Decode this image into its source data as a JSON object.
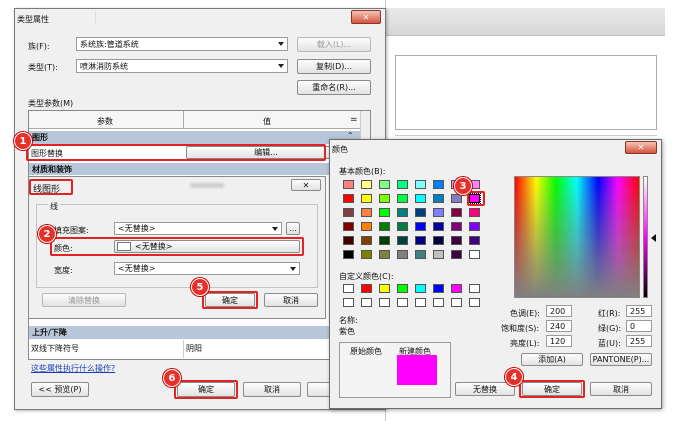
{
  "type_dialog": {
    "title": "类型属性",
    "family_label": "族(F):",
    "family_value": "系统族:管道系统",
    "type_label": "类型(T):",
    "type_value": "喷淋消防系统",
    "load_btn": "载入(L)...",
    "copy_btn": "复制(D)...",
    "rename_btn": "重命名(R)...",
    "params_label": "类型参数(M)",
    "col_param": "参数",
    "col_value": "值",
    "group_graphics": "图形",
    "row_override": "图形替换",
    "edit_btn": "编辑...",
    "group_material": "材质和装饰",
    "group_rise": "上升/下降",
    "row_double": "双线下降符号",
    "row_double_value": "阴阳",
    "help_link": "这些属性执行什么操作?",
    "preview_btn": "<< 预览(P)",
    "ok_btn": "确定",
    "cancel_btn": "取消"
  },
  "line_dialog": {
    "title": "线图形",
    "group": "线",
    "fill_label": "填充图案:",
    "fill_value": "<无替换>",
    "color_label": "颜色:",
    "color_value": "<无替换>",
    "width_label": "宽度:",
    "width_value": "<无替换>",
    "clear_btn": "清除替换",
    "ok_btn": "确定",
    "cancel_btn": "取消"
  },
  "color_dialog": {
    "title": "颜色",
    "basic_label": "基本颜色(B):",
    "custom_label": "自定义颜色(C):",
    "name_label": "名称:",
    "name_value": "紫色",
    "original_label": "原始颜色",
    "new_label": "新建颜色",
    "new_color": "#ff00ff",
    "hue_label": "色调(E):",
    "hue_value": "200",
    "sat_label": "饱和度(S):",
    "sat_value": "240",
    "lum_label": "亮度(L):",
    "lum_value": "120",
    "red_label": "红(R):",
    "red_value": "255",
    "green_label": "绿(G):",
    "green_value": "0",
    "blue_label": "蓝(U):",
    "blue_value": "255",
    "add_btn": "添加(A)",
    "pantone_btn": "PANTONE(P)...",
    "none_btn": "无替换",
    "ok_btn": "确定",
    "cancel_btn": "取消",
    "basic_colors": [
      [
        "#ff8080",
        "#ffff80",
        "#80ff80",
        "#00ff80",
        "#80ffff",
        "#0080ff",
        "#ff80c0",
        "#ff80ff"
      ],
      [
        "#ff0000",
        "#ffff00",
        "#80ff00",
        "#00ff40",
        "#00ffff",
        "#0080c0",
        "#8080c0",
        "#ff00ff"
      ],
      [
        "#804040",
        "#ff8040",
        "#00ff00",
        "#008080",
        "#004080",
        "#8080ff",
        "#800040",
        "#ff0080"
      ],
      [
        "#800000",
        "#ff8000",
        "#008000",
        "#008040",
        "#0000ff",
        "#0000a0",
        "#800080",
        "#8000ff"
      ],
      [
        "#400000",
        "#804000",
        "#004000",
        "#004040",
        "#000080",
        "#000040",
        "#400040",
        "#400080"
      ],
      [
        "#000000",
        "#808000",
        "#808040",
        "#808080",
        "#408080",
        "#c0c0c0",
        "#400040",
        "#ffffff"
      ]
    ],
    "custom_colors": [
      "#ffffff",
      "#ff0000",
      "#ffff00",
      "#00ff00",
      "#00ffff",
      "#0000ff",
      "#ff00ff",
      "#ffffff"
    ]
  },
  "badges": [
    "1",
    "2",
    "3",
    "4",
    "5",
    "6"
  ]
}
